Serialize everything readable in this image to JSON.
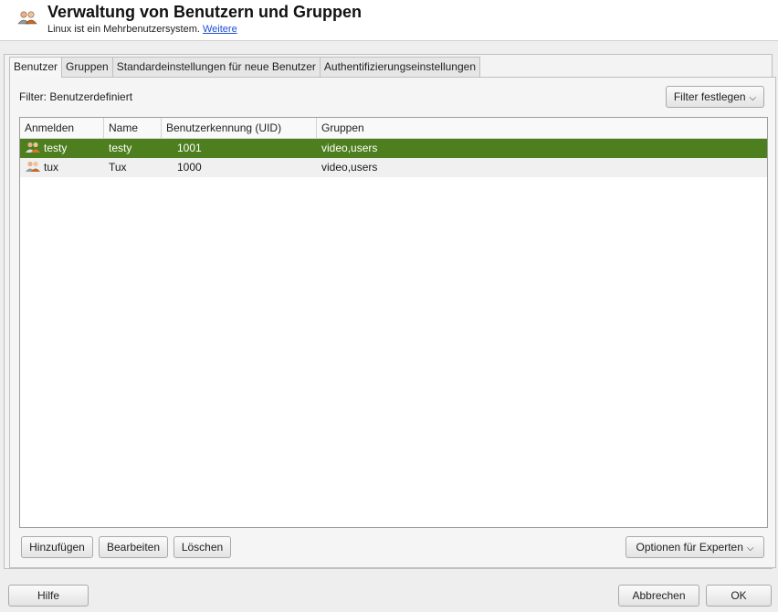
{
  "header": {
    "title": "Verwaltung von Benutzern und Gruppen",
    "subtitle": "Linux ist ein Mehrbenutzersystem.",
    "link": "Weitere",
    "icon": "users-icon"
  },
  "tabs": [
    {
      "label": "Benutzer",
      "active": true
    },
    {
      "label": "Gruppen",
      "active": false
    },
    {
      "label": "Standardeinstellungen für neue Benutzer",
      "active": false
    },
    {
      "label": "Authentifizierungseinstellungen",
      "active": false
    }
  ],
  "filter": {
    "label": "Filter: Benutzerdefiniert",
    "button": "Filter festlegen"
  },
  "table": {
    "columns": [
      "Anmelden",
      "Name",
      "Benutzerkennung (UID)",
      "Gruppen"
    ],
    "rows": [
      {
        "login": "testy",
        "name": "testy",
        "uid": "1001",
        "groups": "video,users",
        "selected": true
      },
      {
        "login": "tux",
        "name": "Tux",
        "uid": "1000",
        "groups": "video,users",
        "selected": false
      }
    ]
  },
  "actions": {
    "add": "Hinzufügen",
    "edit": "Bearbeiten",
    "delete": "Löschen",
    "expert": "Optionen für Experten"
  },
  "footer": {
    "help": "Hilfe",
    "cancel": "Abbrechen",
    "ok": "OK"
  },
  "colors": {
    "selection": "#4e7f1f",
    "link": "#1a4fd6"
  }
}
